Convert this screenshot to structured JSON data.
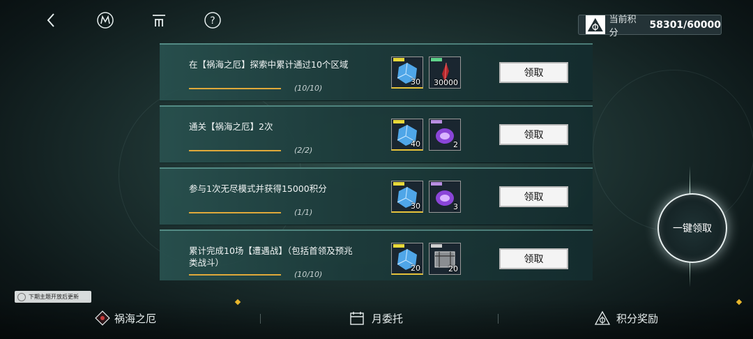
{
  "header": {
    "back_icon": "chevron-left-icon",
    "m_icon": "m-logo-icon",
    "list_icon": "list-icon",
    "help_icon": "question-icon",
    "score_label": "当前积分",
    "score_value": "58301/60000"
  },
  "tasks": [
    {
      "title": "在【祸海之厄】探索中累计通过10个区域",
      "progress": "(10/10)",
      "progress_fraction": 1.0,
      "rewards": [
        {
          "icon": "blue-cube-item",
          "qty": "30"
        },
        {
          "icon": "red-crystal-item",
          "qty": "30000"
        }
      ],
      "claim_label": "领取"
    },
    {
      "title": "通关【祸海之厄】2次",
      "progress": "(2/2)",
      "progress_fraction": 1.0,
      "rewards": [
        {
          "icon": "blue-cube-item",
          "qty": "40"
        },
        {
          "icon": "purple-orb-item",
          "qty": "2"
        }
      ],
      "claim_label": "领取"
    },
    {
      "title": "参与1次无尽模式并获得15000积分",
      "progress": "(1/1)",
      "progress_fraction": 1.0,
      "rewards": [
        {
          "icon": "blue-cube-item",
          "qty": "30"
        },
        {
          "icon": "purple-orb-item",
          "qty": "3"
        }
      ],
      "claim_label": "领取"
    },
    {
      "title": "累计完成10场【遭遇战】（包括首领及预兆类战斗）",
      "progress": "(10/10)",
      "progress_fraction": 1.0,
      "rewards": [
        {
          "icon": "blue-cube-item",
          "qty": "20"
        },
        {
          "icon": "grey-box-item",
          "qty": "20"
        }
      ],
      "claim_label": "领取"
    }
  ],
  "claim_all_label": "一键领取",
  "notice": "下期主题开放后更新",
  "nav": {
    "tab1": "祸海之厄",
    "tab2": "月委托",
    "tab3": "积分奖励"
  },
  "colors": {
    "accent_gold": "#e0a93a",
    "panel": "#2b4f4d"
  }
}
